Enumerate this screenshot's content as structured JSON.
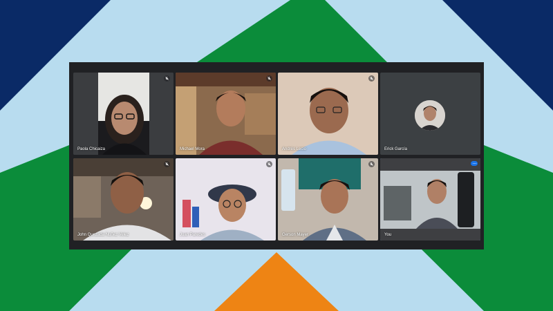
{
  "colors": {
    "background": "#b8dcef",
    "navy": "#0a2a66",
    "green": "#0b8c3a",
    "orange": "#ee8414",
    "window": "#202124",
    "tile": "#3c4043",
    "active_outline": "#8ab4f8"
  },
  "participants": [
    {
      "name": "Paola Chicaiza",
      "muted": true,
      "icon": "mic-off-icon"
    },
    {
      "name": "Michael Mora",
      "muted": true,
      "icon": "mic-off-icon"
    },
    {
      "name": "Andrés Lecio",
      "muted": true,
      "icon": "mic-off-icon"
    },
    {
      "name": "Erick García",
      "muted": false,
      "camera_off": true,
      "icon": "avatar"
    },
    {
      "name": "John Quezada Nuñez Velez",
      "muted": true,
      "icon": "mic-off-icon"
    },
    {
      "name": "Juan Paredes",
      "muted": true,
      "icon": "mic-off-icon"
    },
    {
      "name": "Gerson Mayer",
      "muted": true,
      "icon": "mic-off-icon"
    },
    {
      "name": "You",
      "muted": false,
      "speaking": true,
      "icon": "speaking-indicator-icon"
    }
  ]
}
